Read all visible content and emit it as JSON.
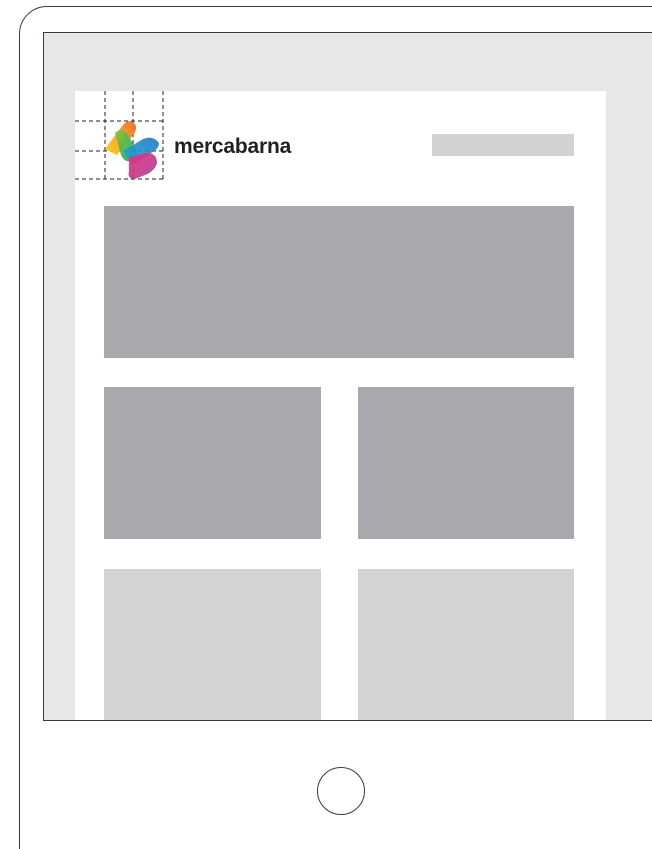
{
  "brand": {
    "name": "mercabarna"
  },
  "colors": {
    "frame_outline": "#3a3a3c",
    "bezel_fill": "#e6e7e8",
    "placeholder_dark": "#a7a9ac",
    "placeholder_light": "#d1d3d4",
    "logo_orange": "#f7a21b",
    "logo_green": "#3bb54a",
    "logo_blue": "#2f8fd8",
    "logo_pink": "#e2468f"
  },
  "icons": {
    "logo": "mercabarna-logo-mark",
    "home_button": "circle-home-button"
  }
}
